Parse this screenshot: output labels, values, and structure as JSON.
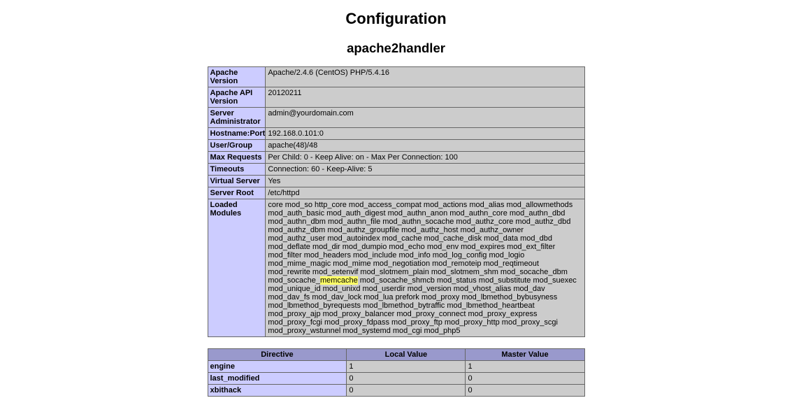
{
  "page": {
    "title": "Configuration",
    "section": "apache2handler"
  },
  "info": {
    "rows": [
      {
        "key": "Apache Version",
        "value": "Apache/2.4.6 (CentOS) PHP/5.4.16"
      },
      {
        "key": "Apache API Version",
        "value": "20120211"
      },
      {
        "key": "Server Administrator",
        "value": "admin@yourdomain.com"
      },
      {
        "key": "Hostname:Port",
        "value": "192.168.0.101:0"
      },
      {
        "key": "User/Group",
        "value": "apache(48)/48"
      },
      {
        "key": "Max Requests",
        "value": "Per Child: 0 - Keep Alive: on - Max Per Connection: 100"
      },
      {
        "key": "Timeouts",
        "value": "Connection: 60 - Keep-Alive: 5"
      },
      {
        "key": "Virtual Server",
        "value": "Yes"
      },
      {
        "key": "Server Root",
        "value": "/etc/httpd"
      }
    ],
    "modules": {
      "key": "Loaded Modules",
      "before": "core mod_so http_core mod_access_compat mod_actions mod_alias mod_allowmethods mod_auth_basic mod_auth_digest mod_authn_anon mod_authn_core mod_authn_dbd mod_authn_dbm mod_authn_file mod_authn_socache mod_authz_core mod_authz_dbd mod_authz_dbm mod_authz_groupfile mod_authz_host mod_authz_owner mod_authz_user mod_autoindex mod_cache mod_cache_disk mod_data mod_dbd mod_deflate mod_dir mod_dumpio mod_echo mod_env mod_expires mod_ext_filter mod_filter mod_headers mod_include mod_info mod_log_config mod_logio mod_mime_magic mod_mime mod_negotiation mod_remoteip mod_reqtimeout mod_rewrite mod_setenvif mod_slotmem_plain mod_slotmem_shm mod_socache_dbm mod_socache_",
      "highlight": "memcache",
      "after": " mod_socache_shmcb mod_status mod_substitute mod_suexec mod_unique_id mod_unixd mod_userdir mod_version mod_vhost_alias mod_dav mod_dav_fs mod_dav_lock mod_lua prefork mod_proxy mod_lbmethod_bybusyness mod_lbmethod_byrequests mod_lbmethod_bytraffic mod_lbmethod_heartbeat mod_proxy_ajp mod_proxy_balancer mod_proxy_connect mod_proxy_express mod_proxy_fcgi mod_proxy_fdpass mod_proxy_ftp mod_proxy_http mod_proxy_scgi mod_proxy_wstunnel mod_systemd mod_cgi mod_php5"
    }
  },
  "directives": {
    "headers": [
      "Directive",
      "Local Value",
      "Master Value"
    ],
    "rows": [
      {
        "name": "engine",
        "local": "1",
        "master": "1"
      },
      {
        "name": "last_modified",
        "local": "0",
        "master": "0"
      },
      {
        "name": "xbithack",
        "local": "0",
        "master": "0"
      }
    ]
  },
  "colors": {
    "key_cell": "#ccccff",
    "value_cell": "#cccccc",
    "header_cell": "#9999cc",
    "search_highlight": "#ffff66"
  }
}
